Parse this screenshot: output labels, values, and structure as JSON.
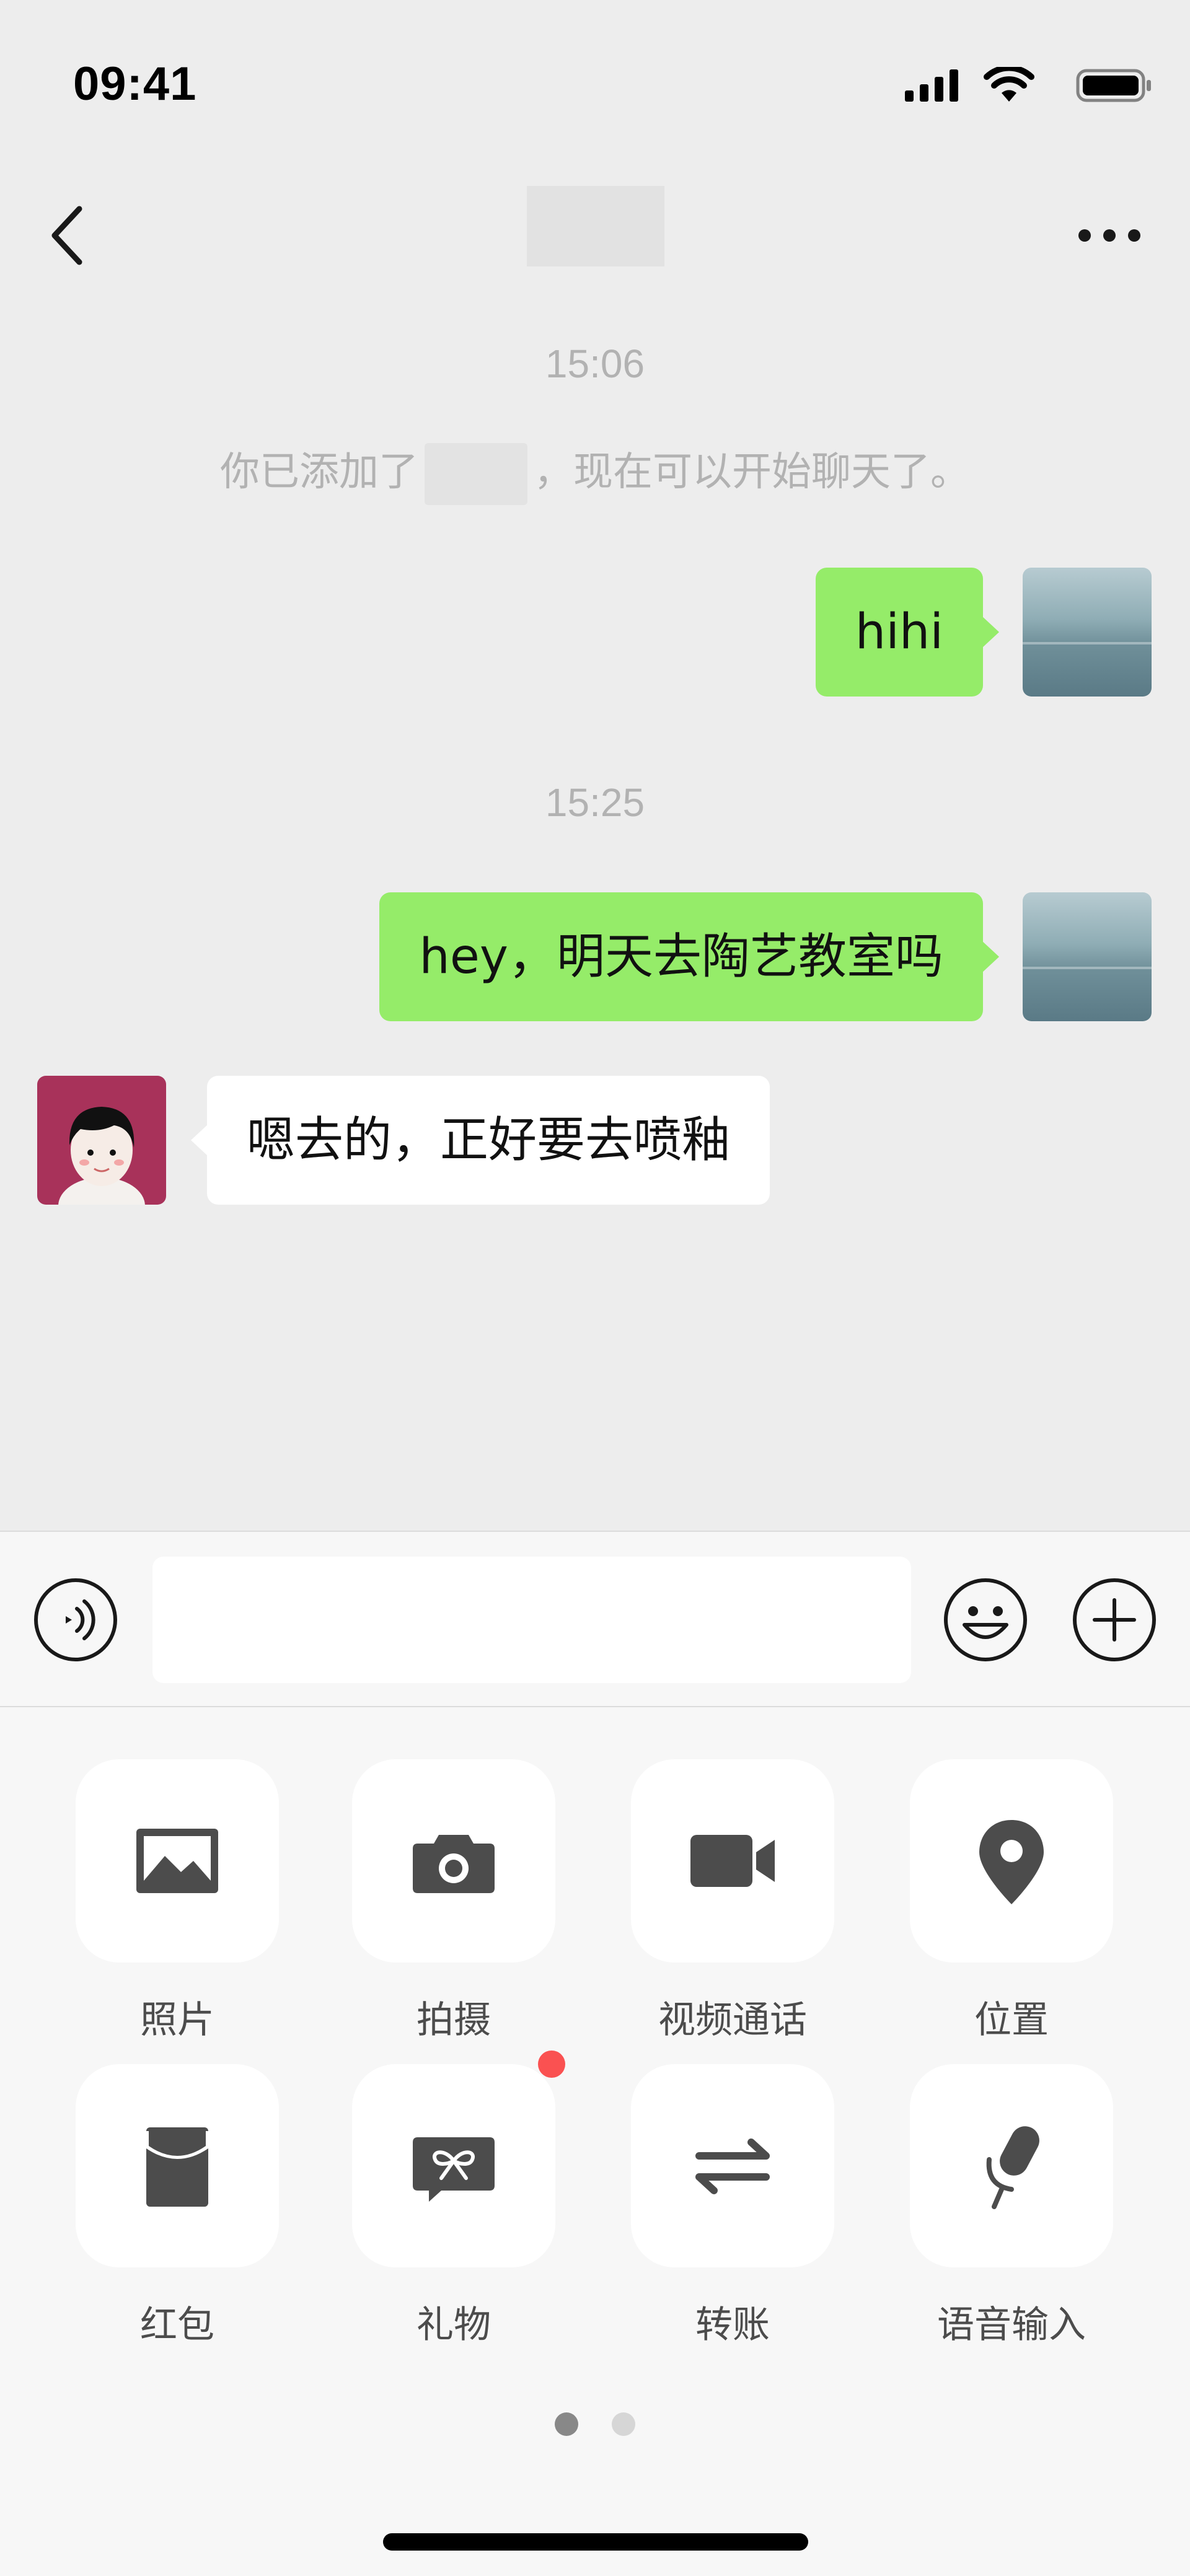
{
  "status_bar": {
    "time": "09:41"
  },
  "nav": {
    "title": ""
  },
  "chat": {
    "timestamps": [
      "15:06",
      "15:25"
    ],
    "system_message": {
      "prefix": "你已添加了",
      "suffix": "，现在可以开始聊天了。"
    },
    "messages": [
      {
        "side": "out",
        "text": "hihi"
      },
      {
        "side": "out",
        "text": "hey，明天去陶艺教室吗"
      },
      {
        "side": "in",
        "text": "嗯去的，正好要去喷釉"
      }
    ]
  },
  "input": {
    "value": "",
    "placeholder": ""
  },
  "actions": [
    {
      "label": "照片",
      "icon": "photo-icon"
    },
    {
      "label": "拍摄",
      "icon": "camera-icon"
    },
    {
      "label": "视频通话",
      "icon": "video-call-icon"
    },
    {
      "label": "位置",
      "icon": "location-icon"
    },
    {
      "label": "红包",
      "icon": "red-packet-icon"
    },
    {
      "label": "礼物",
      "icon": "gift-icon",
      "badge": true
    },
    {
      "label": "转账",
      "icon": "transfer-icon"
    },
    {
      "label": "语音输入",
      "icon": "voice-input-icon"
    }
  ],
  "pagination": {
    "current": 1,
    "total": 2
  },
  "colors": {
    "outgoing_bubble": "#95ec69",
    "incoming_bubble": "#ffffff",
    "badge": "#fa5151",
    "icon": "#4c4c4c"
  }
}
